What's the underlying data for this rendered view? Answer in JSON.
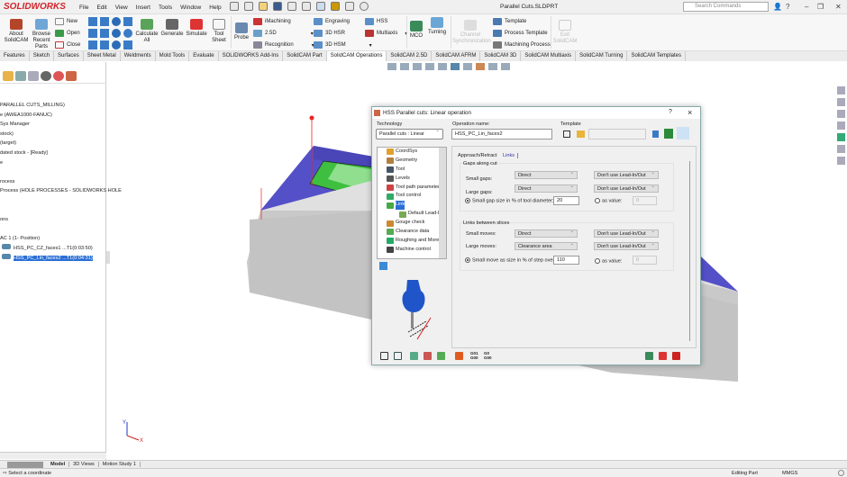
{
  "app": {
    "logo": "SOLIDWORKS",
    "document_title": "Parallel Cuts.SLDPRT",
    "search_placeholder": "Search Commands"
  },
  "menu": [
    "File",
    "Edit",
    "View",
    "Insert",
    "Tools",
    "Window",
    "Help"
  ],
  "ribbon": {
    "about": "About SolidCAM",
    "browse": "Browse Recent Parts",
    "new": "New",
    "open": "Open",
    "close": "Close",
    "calculate": "Calculate All",
    "generate": "Generate",
    "simulate": "Simulate",
    "tool_sheet": "Tool Sheet",
    "probe": "Probe",
    "imachining": "iMachining",
    "d25": "2.5D",
    "recognition": "Recognition",
    "engraving": "Engraving",
    "hsr": "3D HSR",
    "hsm": "3D HSM",
    "hss": "HSS",
    "multiaxis": "Multiaxis",
    "mco": "MCO",
    "turning": "Turning",
    "channel_sync": "Channel Synchronization",
    "template": "Template",
    "process_template": "Process Template",
    "machining_process": "Machining Process",
    "exit": "Exit SolidCAM"
  },
  "tabs": [
    "Features",
    "Sketch",
    "Surfaces",
    "Sheet Metal",
    "Weldments",
    "Mold Tools",
    "Evaluate",
    "SOLIDWORKS Add-Ins",
    "SolidCAM Part",
    "SolidCAM Operations",
    "SolidCAM 2.5D",
    "SolidCAM AFRM",
    "SolidCAM 3D",
    "SolidCAM Multiaxis",
    "SolidCAM Turning",
    "SolidCAM Templates"
  ],
  "active_tab": "SolidCAM Operations",
  "tree": [
    "PARALLEL CUTS_MILLING)",
    "e (AWEA1000-FANUC)",
    "Sys Manager",
    "stock)",
    "(target)",
    "dated stock - [Ready]",
    "e",
    "",
    "rocess",
    "Process (HOLE PROCESSES - SOLIDWORKS HOLE",
    "",
    "",
    "ons",
    "",
    "AC 1 (1- Position)",
    "HSS_PC_CZ_faces1 ...T1(0:03:50)",
    "HSS_PC_Lin_faces2 ...T1(0:04:31)"
  ],
  "dialog": {
    "title": "HSS Parallel cuts: Linear operation",
    "help": "?",
    "close": "×",
    "technology_label": "Technology",
    "technology_value": "Parallel cuts : Linear",
    "opname_label": "Operation name:",
    "opname_value": "HSS_PC_Lin_faces2",
    "template_label": "Template",
    "template_value": "",
    "nav": [
      "CoordSys",
      "Geometry",
      "Tool",
      "Levels",
      "Tool path parameters",
      "Tool control",
      "Link",
      "Default Lead-In",
      "Gouge check",
      "Clearance data",
      "Roughing and More",
      "Machine control"
    ],
    "nav_selected": "Link",
    "subtabs": [
      "Approach/Retract",
      "Links"
    ],
    "active_subtab": "Links",
    "gaps": {
      "title": "Gaps along cut",
      "small_label": "Small gaps:",
      "small_value": "Direct",
      "small_lead": "Don't use Lead-In/Out",
      "large_label": "Large gaps:",
      "large_value": "Direct",
      "large_lead": "Don't use Lead-In/Out",
      "pct_label": "Small gap size in % of tool diameter:",
      "pct_value": "20",
      "asvalue_label": "as value:",
      "asvalue_value": "0"
    },
    "links": {
      "title": "Links between slices",
      "small_label": "Small moves:",
      "small_value": "Direct",
      "small_lead": "Don't use Lead-In/Out",
      "large_label": "Large moves:",
      "large_value": "Clearance area",
      "large_lead": "Don't use Lead-In/Out",
      "pct_label": "Small move as size in % of step over:",
      "pct_value": "110",
      "asvalue_label": "as value:",
      "asvalue_value": "0"
    },
    "gcode1": "G01 G00",
    "gcode2": "G0 G00"
  },
  "bottom_tabs": [
    "Model",
    "3D Views",
    "Motion Study 1"
  ],
  "status": {
    "message": "Select a coordinate",
    "mode": "Editing Part",
    "units": "MMGS"
  }
}
